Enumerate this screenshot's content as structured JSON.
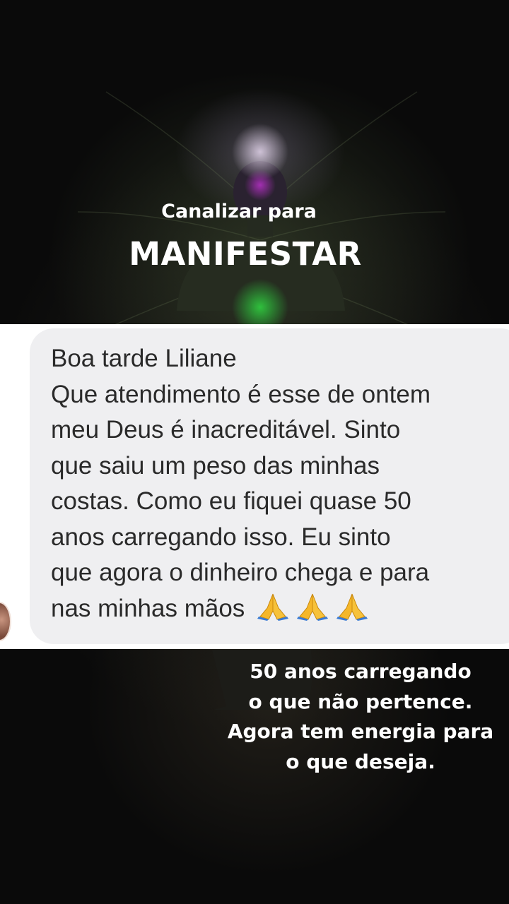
{
  "header": {
    "subtitle": "Canalizar para",
    "title": "MANIFESTAR"
  },
  "message": {
    "lines": [
      "Boa tarde Liliane",
      "Que atendimento é esse de ontem",
      "meu Deus é inacreditável. Sinto",
      "que saiu um peso das minhas",
      "costas. Como eu fiquei quase 50",
      "anos carregando isso. Eu sinto",
      "que agora o dinheiro chega e para",
      "nas minhas mãos"
    ],
    "emoji_icons": [
      "praying-hands-icon",
      "praying-hands-icon",
      "praying-hands-icon"
    ]
  },
  "caption": {
    "lines": [
      "50 anos carregando",
      "o que não pertence.",
      "Agora tem energia para",
      "o que deseja."
    ]
  },
  "colors": {
    "background": "#0a0a0a",
    "band": "#ffffff",
    "bubble": "#efeff1",
    "message_text": "#2a2a2a",
    "overlay_text": "#ffffff"
  }
}
